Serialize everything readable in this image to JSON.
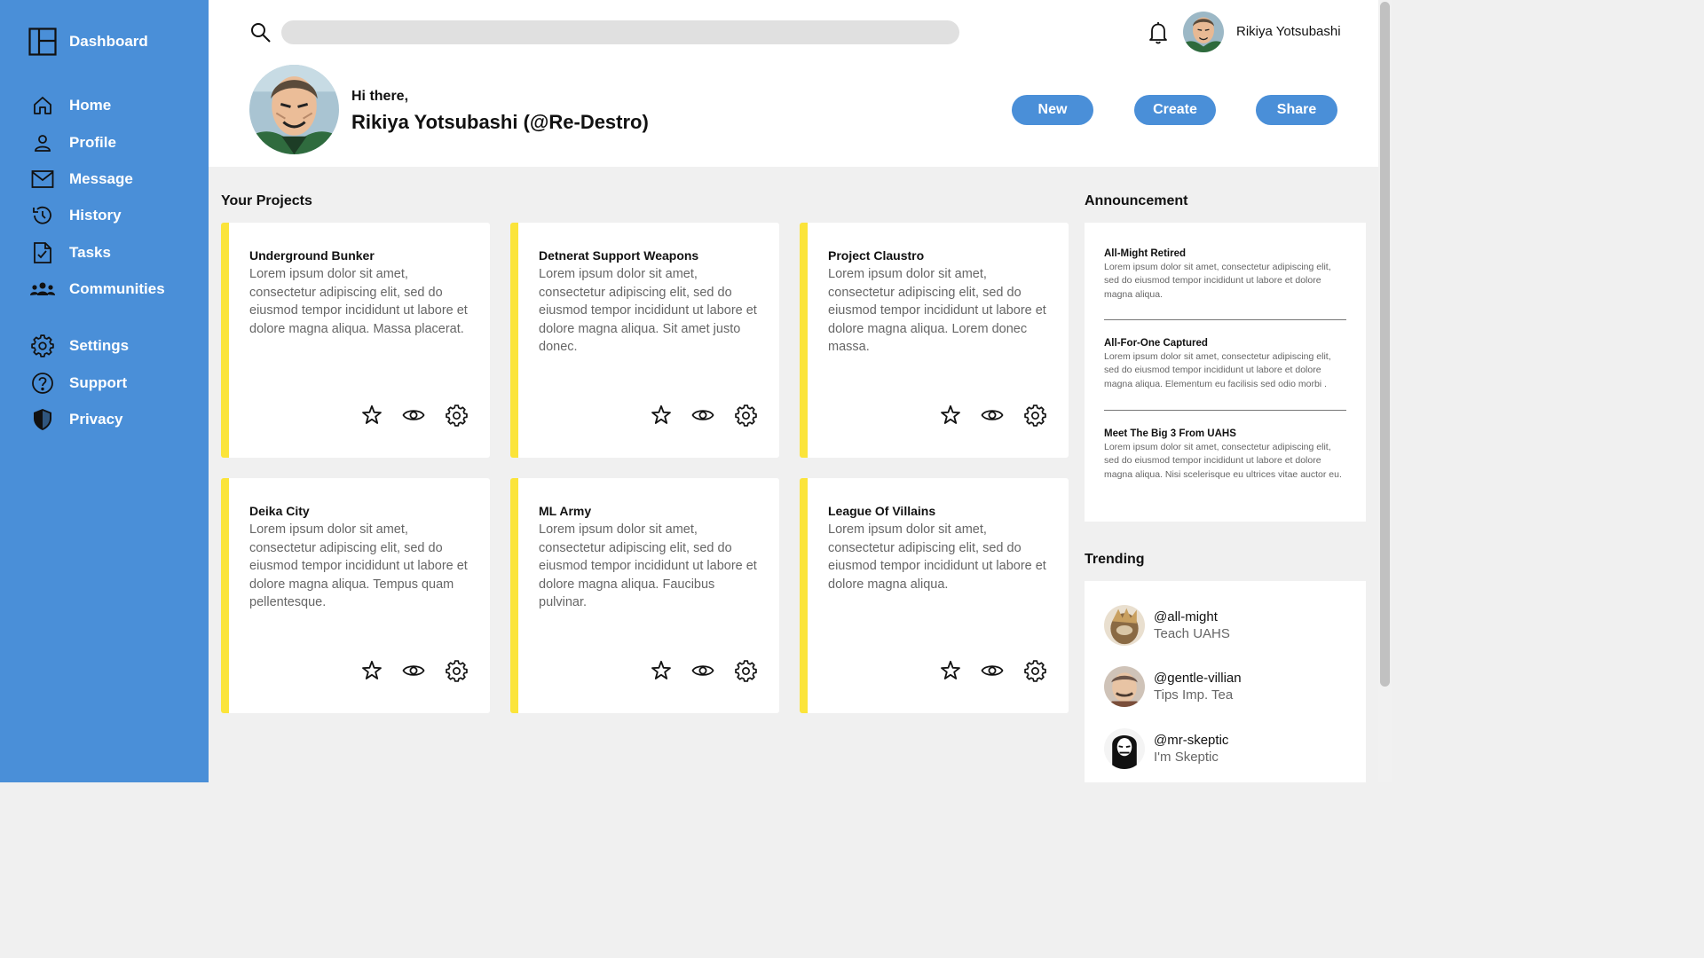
{
  "sidebar": {
    "brand": "Dashboard",
    "items": [
      {
        "label": "Home",
        "icon": "home-icon"
      },
      {
        "label": "Profile",
        "icon": "user-icon"
      },
      {
        "label": "Message",
        "icon": "mail-icon"
      },
      {
        "label": "History",
        "icon": "history-icon"
      },
      {
        "label": "Tasks",
        "icon": "tasks-icon"
      },
      {
        "label": "Communities",
        "icon": "communities-icon"
      },
      {
        "label": "Settings",
        "icon": "gear-icon"
      },
      {
        "label": "Support",
        "icon": "help-icon"
      },
      {
        "label": "Privacy",
        "icon": "shield-icon"
      }
    ]
  },
  "header": {
    "search_placeholder": "",
    "user_name": "Rikiya Yotsubashi",
    "greeting": "Hi there,",
    "full_name": "Rikiya Yotsubashi (@Re-Destro)",
    "buttons": {
      "new": "New",
      "create": "Create",
      "share": "Share"
    }
  },
  "projects": {
    "title": "Your Projects",
    "items": [
      {
        "title": "Underground Bunker",
        "text": "Lorem ipsum dolor sit amet, consectetur adipiscing elit, sed do eiusmod tempor incididunt ut labore et dolore magna aliqua. Massa placerat."
      },
      {
        "title": "Detnerat Support Weapons",
        "text": "Lorem ipsum dolor sit amet, consectetur adipiscing elit, sed do eiusmod tempor incididunt ut labore et dolore magna aliqua. Sit amet justo donec."
      },
      {
        "title": "Project Claustro",
        "text": "Lorem ipsum dolor sit amet, consectetur adipiscing elit, sed do eiusmod tempor incididunt ut labore et dolore magna aliqua. Lorem donec massa."
      },
      {
        "title": "Deika City",
        "text": "Lorem ipsum dolor sit amet, consectetur adipiscing elit, sed do eiusmod tempor incididunt ut labore et dolore magna aliqua. Tempus quam pellentesque."
      },
      {
        "title": "ML Army",
        "text": "Lorem ipsum dolor sit amet, consectetur adipiscing elit, sed do eiusmod tempor incididunt ut labore et dolore magna aliqua. Faucibus pulvinar."
      },
      {
        "title": "League Of Villains",
        "text": "Lorem ipsum dolor sit amet, consectetur adipiscing elit, sed do eiusmod tempor incididunt ut labore et dolore magna aliqua."
      }
    ]
  },
  "announcements": {
    "title": "Announcement",
    "items": [
      {
        "title": "All-Might Retired",
        "text": "Lorem ipsum dolor sit amet, consectetur adipiscing elit, sed do eiusmod tempor incididunt ut labore et dolore magna aliqua."
      },
      {
        "title": "All-For-One Captured",
        "text": "Lorem ipsum dolor sit amet, consectetur adipiscing elit, sed do eiusmod tempor incididunt ut labore et dolore magna aliqua. Elementum eu facilisis sed odio morbi ."
      },
      {
        "title": "Meet The Big 3 From UAHS",
        "text": "Lorem ipsum dolor sit amet, consectetur adipiscing elit, sed do eiusmod tempor incididunt ut labore et dolore magna aliqua. Nisi scelerisque eu ultrices vitae auctor eu."
      }
    ]
  },
  "trending": {
    "title": "Trending",
    "items": [
      {
        "handle": "@all-might",
        "subtitle": "Teach UAHS"
      },
      {
        "handle": "@gentle-villian",
        "subtitle": "Tips Imp. Tea"
      },
      {
        "handle": "@mr-skeptic",
        "subtitle": "I'm Skeptic"
      }
    ]
  },
  "colors": {
    "accent": "#4a8fd8",
    "card_border": "#fbe43a",
    "background": "#f0f0f0"
  }
}
